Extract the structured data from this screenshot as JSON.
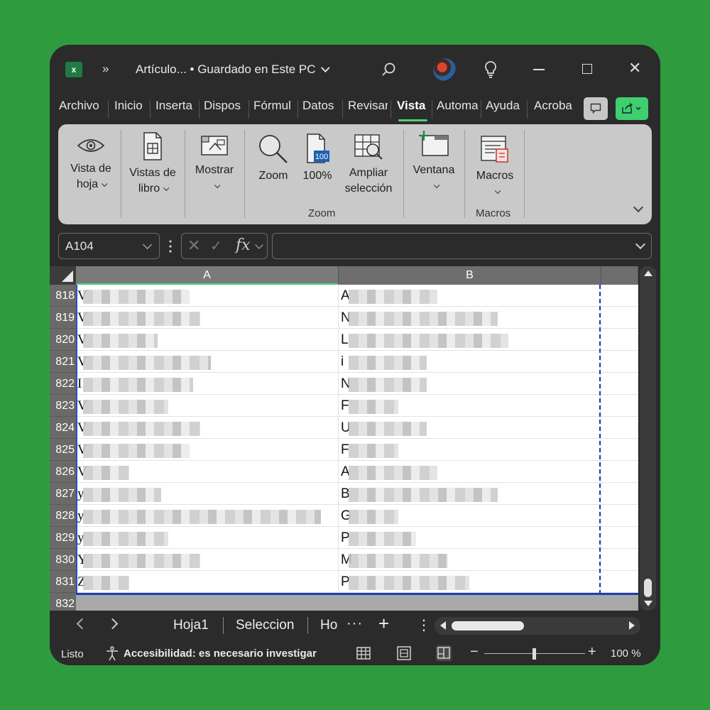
{
  "titlebar": {
    "app_icon": "excel-icon",
    "overflow": "»",
    "doc_title": "Artículo... • Guardado en Este PC",
    "search_icon": "search-icon",
    "bulb_icon": "lightbulb-icon",
    "minimize_icon": "minimize-icon",
    "maximize_icon": "maximize-icon",
    "close_label": "✕"
  },
  "tabs": [
    "Archivo",
    "Inicio",
    "Inserta",
    "Dispos",
    "Fórmul",
    "Datos",
    "Revisar",
    "Vista",
    "Automa",
    "Ayuda",
    "Acroba"
  ],
  "active_tab": "Vista",
  "ribbon": {
    "vista_hoja_1": "Vista de",
    "vista_hoja_2": "hoja",
    "vistas_libro_1": "Vistas de",
    "vistas_libro_2": "libro",
    "mostrar": "Mostrar",
    "zoom": "Zoom",
    "zoom100": "100%",
    "zoom100_badge": "100",
    "ampliar_1": "Ampliar",
    "ampliar_2": "selección",
    "ventana": "Ventana",
    "macros": "Macros",
    "group_zoom": "Zoom",
    "group_macros": "Macros"
  },
  "formula_bar": {
    "name_box": "A104",
    "fx": "fx",
    "formula": ""
  },
  "columns": [
    "A",
    "B"
  ],
  "rows": [
    {
      "num": "818",
      "a": "V",
      "b": "A"
    },
    {
      "num": "819",
      "a": "V",
      "b": "N"
    },
    {
      "num": "820",
      "a": "V",
      "b": "L"
    },
    {
      "num": "821",
      "a": "V",
      "b": "i"
    },
    {
      "num": "822",
      "a": "I",
      "b": "N"
    },
    {
      "num": "823",
      "a": "V",
      "b": "F"
    },
    {
      "num": "824",
      "a": "V",
      "b": "U"
    },
    {
      "num": "825",
      "a": "V",
      "b": "F"
    },
    {
      "num": "826",
      "a": "V",
      "b": "A"
    },
    {
      "num": "827",
      "a": "y",
      "b": "B"
    },
    {
      "num": "828",
      "a": "y",
      "b": "G"
    },
    {
      "num": "829",
      "a": "y",
      "b": "P"
    },
    {
      "num": "830",
      "a": "Y",
      "b": "M"
    },
    {
      "num": "831",
      "a": "Z",
      "b": "P"
    },
    {
      "num": "832",
      "a": "",
      "b": ""
    }
  ],
  "sheets": {
    "tabs": [
      "Hoja1",
      "Seleccion",
      "Ho"
    ],
    "more": "···",
    "add": "+",
    "menu": "⋮"
  },
  "status": {
    "ready": "Listo",
    "accessibility": "Accesibilidad: es necesario investigar",
    "zoom_minus": "−",
    "zoom_plus": "+",
    "zoom_value": "100 %",
    "zoom_level_percent": 100
  },
  "colors": {
    "background": "#2f9b3f",
    "window": "#2b2b2b",
    "ribbon": "#c9c9c9",
    "accent_green": "#4fd07a",
    "page_break": "#1a3fb0"
  }
}
